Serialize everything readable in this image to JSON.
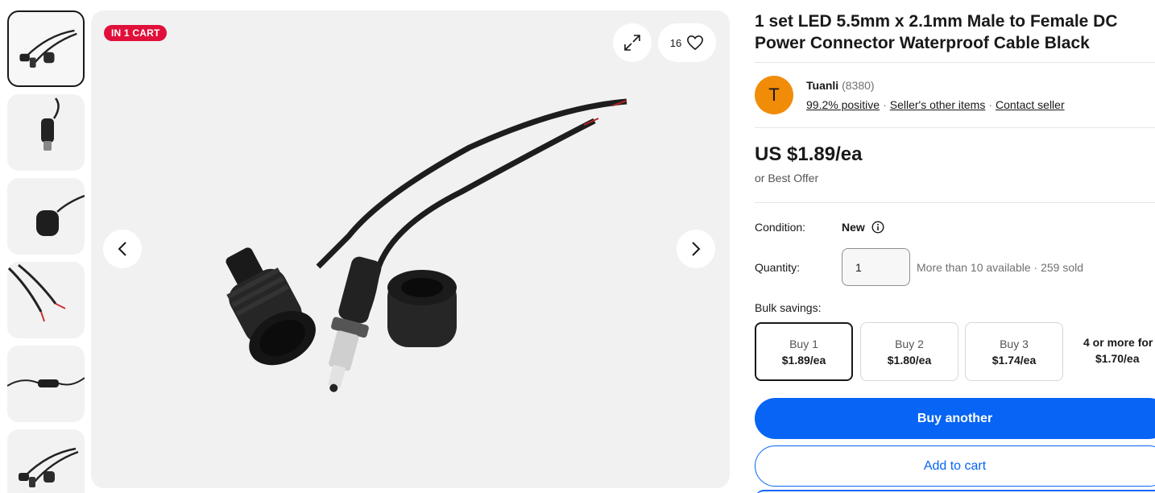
{
  "gallery": {
    "cart_badge": "IN 1 CART",
    "favorite_count": "16",
    "thumbnail_count": 6
  },
  "product": {
    "title": "1 set LED 5.5mm x 2.1mm Male to Female DC Power Connector Waterproof Cable Black"
  },
  "seller": {
    "avatar_letter": "T",
    "name": "Tuanli",
    "feedback_count": "(8380)",
    "positive": "99.2% positive",
    "other_items": "Seller's other items",
    "contact": "Contact seller"
  },
  "pricing": {
    "price": "US $1.89/ea",
    "best_offer": "or Best Offer"
  },
  "details": {
    "condition_label": "Condition:",
    "condition_value": "New",
    "quantity_label": "Quantity:",
    "quantity_value": "1",
    "availability": "More than 10 available · 259 sold",
    "bulk_label": "Bulk savings:"
  },
  "bulk_options": [
    {
      "qty": "Buy 1",
      "price": "$1.89/ea"
    },
    {
      "qty": "Buy 2",
      "price": "$1.80/ea"
    },
    {
      "qty": "Buy 3",
      "price": "$1.74/ea"
    },
    {
      "qty": "4 or more for",
      "price": "$1.70/ea"
    }
  ],
  "actions": {
    "buy_label": "Buy another",
    "cart_label": "Add to cart"
  },
  "colors": {
    "accent_blue": "#0764f4",
    "badge_red": "#e0103a",
    "avatar_orange": "#f18c08"
  }
}
